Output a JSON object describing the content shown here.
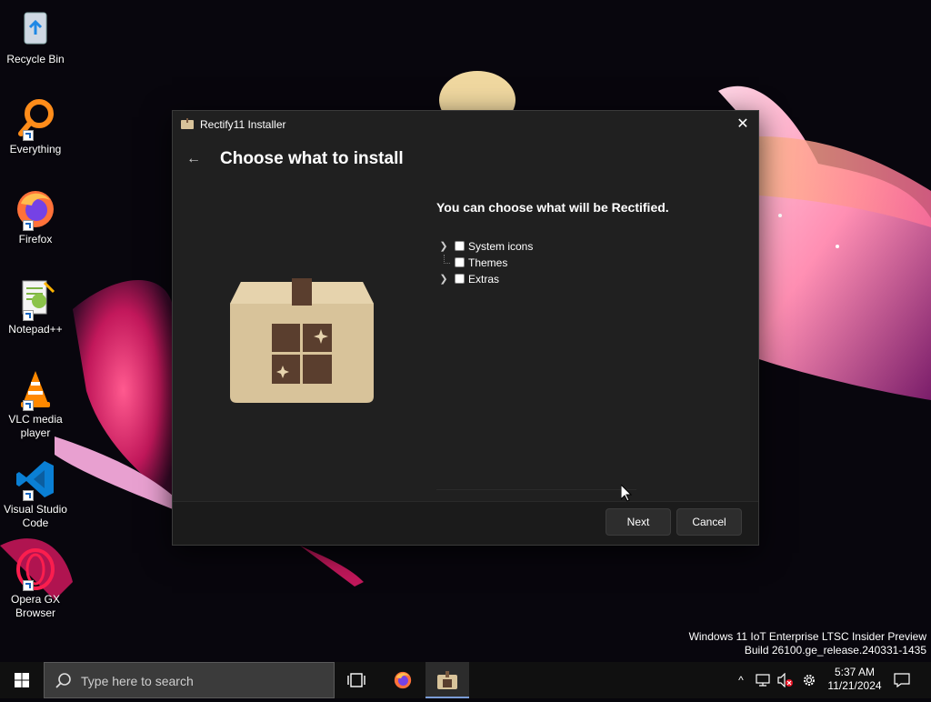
{
  "desktop": {
    "icons": [
      {
        "label": "Recycle Bin",
        "icon": "recycle-bin-icon",
        "shortcut": false
      },
      {
        "label": "Everything",
        "icon": "everything-search-icon",
        "shortcut": true
      },
      {
        "label": "Firefox",
        "icon": "firefox-icon",
        "shortcut": true
      },
      {
        "label": "Notepad++",
        "icon": "notepad-plus-plus-icon",
        "shortcut": true
      },
      {
        "label": "VLC media player",
        "icon": "vlc-icon",
        "shortcut": true
      },
      {
        "label": "Visual Studio Code",
        "icon": "vscode-icon",
        "shortcut": true
      },
      {
        "label": "Opera GX Browser",
        "icon": "opera-gx-icon",
        "shortcut": true
      }
    ],
    "watermark": {
      "line1": "Windows 11 IoT Enterprise LTSC Insider Preview",
      "line2": "Build 26100.ge_release.240331-1435"
    }
  },
  "dialog": {
    "title": "Rectify11 Installer",
    "close_label": "✕",
    "back_label": "←",
    "page_title": "Choose what to install",
    "subtitle": "You can choose what will be Rectified.",
    "options": [
      {
        "label": "System icons",
        "expandable": true,
        "checked": false
      },
      {
        "label": "Themes",
        "expandable": false,
        "checked": false
      },
      {
        "label": "Extras",
        "expandable": true,
        "checked": false
      }
    ],
    "next_label": "Next",
    "cancel_label": "Cancel"
  },
  "taskbar": {
    "search_placeholder": "Type here to search",
    "time": "5:37 AM",
    "date": "11/21/2024",
    "chevron": "^"
  },
  "colors": {
    "dialog_bg": "#202020",
    "footer_bg": "#1b1b1b",
    "taskbar_bg": "#101010",
    "box_tan": "#d8c39a",
    "box_window": "#5a3e2e"
  }
}
